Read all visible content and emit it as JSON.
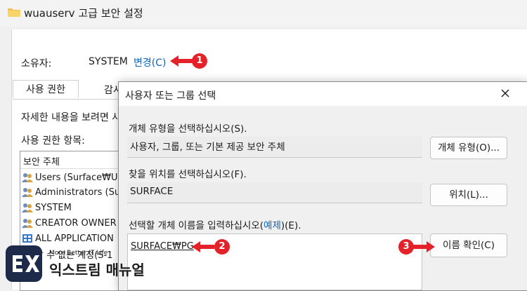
{
  "window": {
    "title": "wuauserv 고급 보안 설정"
  },
  "owner": {
    "label": "소유자:",
    "value": "SYSTEM",
    "change_link": "변경(C)"
  },
  "tabs": [
    "사용 권한",
    "감시"
  ],
  "details_text": "자세한 내용을 보려면 사",
  "permission_entries_label": "사용 권한 항목:",
  "principals": {
    "header": "보안 주체",
    "items": [
      "Users (Surface₩Use",
      "Administrators (Sur",
      "SYSTEM",
      "CREATOR OWNER",
      "ALL APPLICATION",
      "알 수 없는 계정(S-1"
    ]
  },
  "dialog": {
    "title": "사용자 또는 그룹 선택",
    "object_type": {
      "label": "개체 유형을 선택하십시오(S).",
      "value": "사용자, 그룹, 또는 기본 제공 보안 주체",
      "button": "개체 유형(O)..."
    },
    "location": {
      "label": "찾을 위치를 선택하십시오(F).",
      "value": "SURFACE",
      "button": "위치(L)..."
    },
    "object_name": {
      "label_prefix": "선택할 개체 이름을 입력하십시오(",
      "label_link": "예제",
      "label_suffix": ")(E).",
      "value": "SURFACE₩PG",
      "check_button": "이름 확인(C)"
    }
  },
  "annotations": [
    "1",
    "2",
    "3"
  ],
  "watermark": {
    "tagline": "More Better IT Life",
    "name": "익스트림 매뉴얼"
  },
  "colors": {
    "link": "#0d65c0",
    "annotation": "#e3222a",
    "dialog_bg": "#f0f0f0"
  }
}
